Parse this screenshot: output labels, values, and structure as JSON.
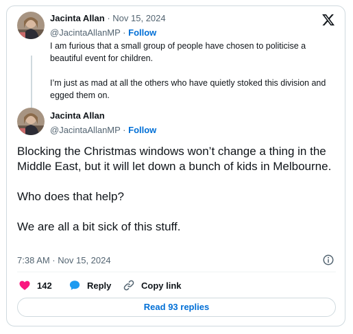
{
  "quoted_tweet": {
    "author_name": "Jacinta Allan",
    "date": "Nov 15, 2024",
    "handle": "@JacintaAllanMP",
    "follow_label": "Follow",
    "paragraphs": [
      "I am furious that a small group of people have chosen to politicise a beautiful event for children.",
      "I’m just as mad at all the others who have quietly stoked this division and egged them on."
    ]
  },
  "main_tweet": {
    "author_name": "Jacinta Allan",
    "handle": "@JacintaAllanMP",
    "follow_label": "Follow",
    "paragraphs": [
      "Blocking the Christmas windows won’t change a thing in the Middle East, but it will let down a bunch of kids in Melbourne.",
      "Who does that help?",
      "We are all a bit sick of this stuff."
    ],
    "timestamp": "7:38 AM · Nov 15, 2024"
  },
  "actions": {
    "like_count": "142",
    "reply_label": "Reply",
    "copy_link_label": "Copy link"
  },
  "read_replies_label": "Read 93 replies",
  "icons": {
    "brand": "x-logo-icon",
    "like": "heart-icon",
    "reply": "speech-bubble-icon",
    "copy": "link-icon",
    "info": "info-icon"
  },
  "colors": {
    "like": "#f91880",
    "link_blue": "#006fd6",
    "reply_bubble": "#1d9bf0",
    "border": "#cfd9de",
    "secondary_text": "#536471"
  }
}
